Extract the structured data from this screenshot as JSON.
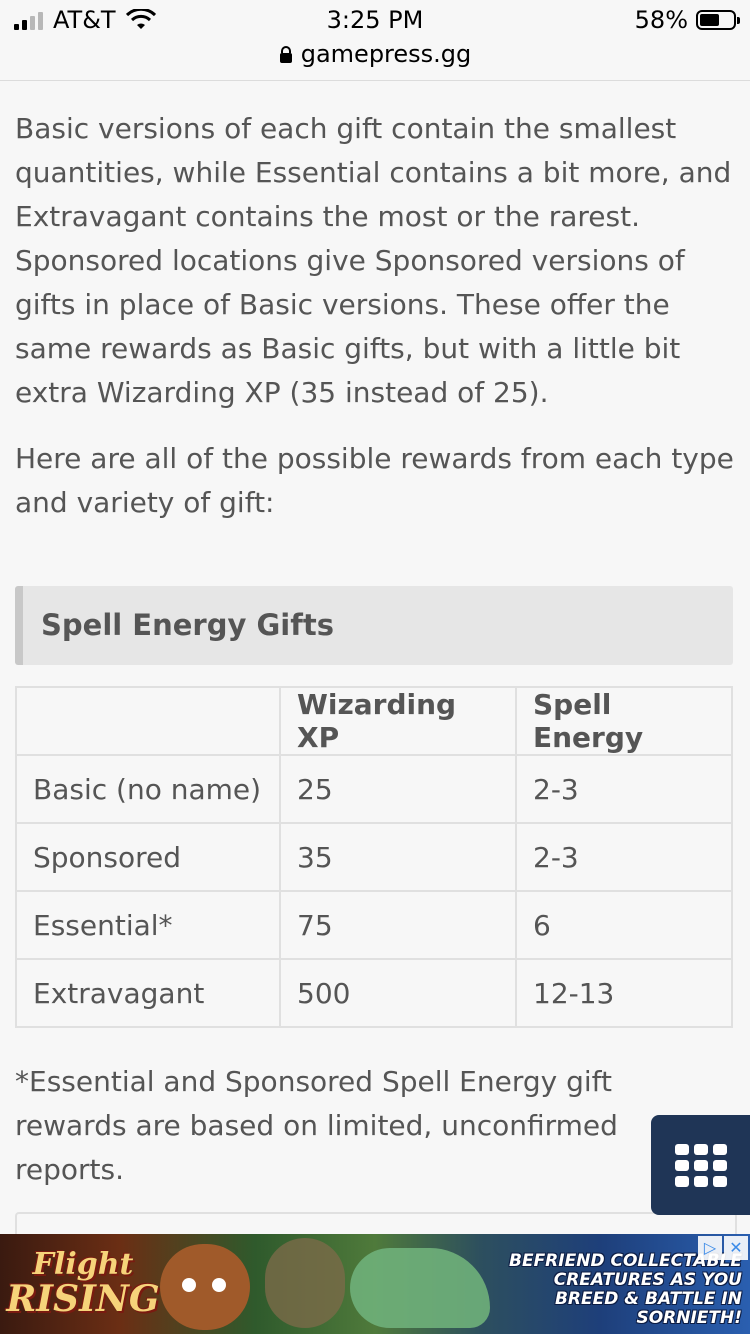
{
  "status_bar": {
    "carrier": "AT&T",
    "time": "3:25 PM",
    "battery": "58%",
    "battery_level": 0.58,
    "url": "gamepress.gg"
  },
  "article": {
    "paragraph_1": "Basic versions of each gift contain the smallest quantities, while Essential contains a bit more, and Extravagant contains the most or the rarest. Sponsored locations give Sponsored versions of gifts in place of Basic versions. These offer the same rewards as Basic gifts, but with a little bit extra Wizarding XP (35 instead of 25).",
    "paragraph_2": "Here are all of the possible rewards from each type and variety of gift:",
    "section_title": "Spell Energy Gifts",
    "table": {
      "headers": [
        "",
        "Wizarding XP",
        "Spell Energy"
      ],
      "rows": [
        [
          "Basic (no name)",
          "25",
          "2-3"
        ],
        [
          "Sponsored",
          "35",
          "2-3"
        ],
        [
          "Essential*",
          "75",
          "6"
        ],
        [
          "Extravagant",
          "500",
          "12-13"
        ]
      ]
    },
    "footnote": "*Essential and Sponsored Spell Energy gift rewards are based on limited, unconfirmed reports."
  },
  "ad": {
    "logo_line1": "Flight",
    "logo_line2": "RISING",
    "tagline": "Befriend collectable creatures as you breed & battle in Sornieth!",
    "adchoices_glyph": "▷",
    "close_glyph": "✕"
  },
  "icons": {
    "menu": "grid-menu-icon",
    "lock": "lock-icon",
    "wifi": "wifi-icon",
    "battery": "battery-icon"
  },
  "colors": {
    "page_bg": "#f7f7f7",
    "text": "#555555",
    "menu_fab": "#1f3556",
    "table_border": "#e0e0e0",
    "section_header_bg": "#e6e6e6"
  }
}
